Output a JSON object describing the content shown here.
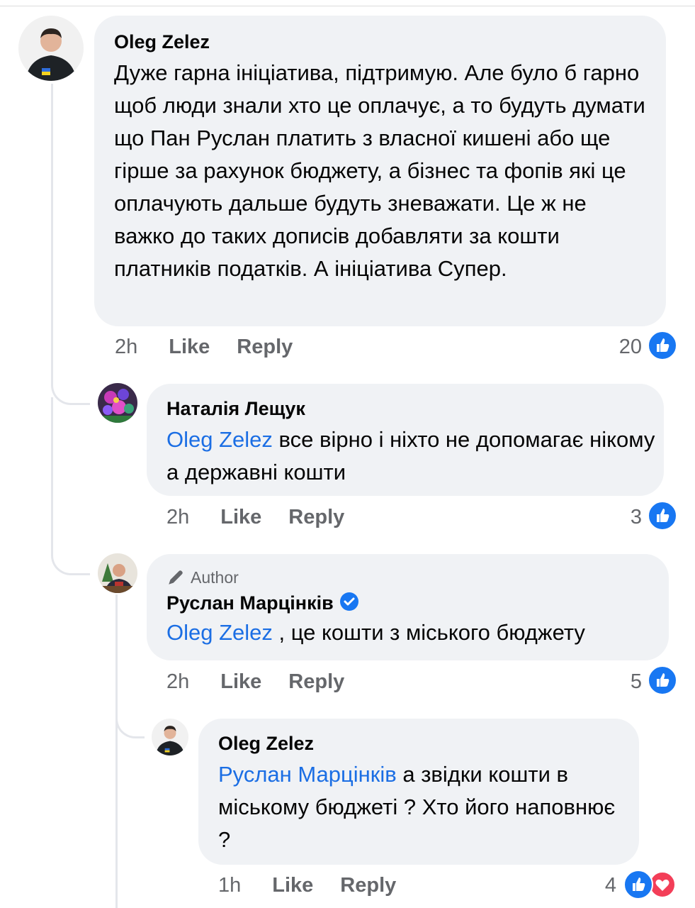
{
  "comments": [
    {
      "author": "Oleg Zelez",
      "text": "Дуже гарна ініціатива, підтримую. Але було б гарно щоб люди знали хто це оплачує, а то будуть думати що Пан Руслан платить з власної кишені або ще гірше за рахунок бюджету, а бізнес та фопів які це оплачують дальше будуть зневажати. Це ж не важко до таких дописів добавляти за кошти платників податків. А ініціатива Супер.",
      "time": "2h",
      "like_label": "Like",
      "reply_label": "Reply",
      "reactions": "20"
    },
    {
      "author": "Наталія Лещук",
      "mention": "Oleg Zelez",
      "text": " все вірно і ніхто не допомагає нікому а державні кошти",
      "time": "2h",
      "like_label": "Like",
      "reply_label": "Reply",
      "reactions": "3"
    },
    {
      "badge": "Author",
      "author": "Руслан Марцінків",
      "mention": "Oleg Zelez",
      "text": " , це кошти з міського бюджету",
      "time": "2h",
      "like_label": "Like",
      "reply_label": "Reply",
      "reactions": "5"
    },
    {
      "author": "Oleg Zelez",
      "mention": "Руслан Марцінків",
      "text": " а звідки кошти в міському бюджеті ? Хто його наповнює ?",
      "time": "1h",
      "like_label": "Like",
      "reply_label": "Reply",
      "reactions": "4"
    }
  ],
  "icons": {
    "like": "thumbs-up-icon",
    "love": "heart-icon",
    "verified": "verified-check-icon",
    "author": "pencil-icon"
  },
  "colors": {
    "bubble": "#f0f2f5",
    "mention": "#1b6ee4",
    "like": "#1877f2",
    "love": "#f33e58",
    "meta": "#65676b"
  }
}
